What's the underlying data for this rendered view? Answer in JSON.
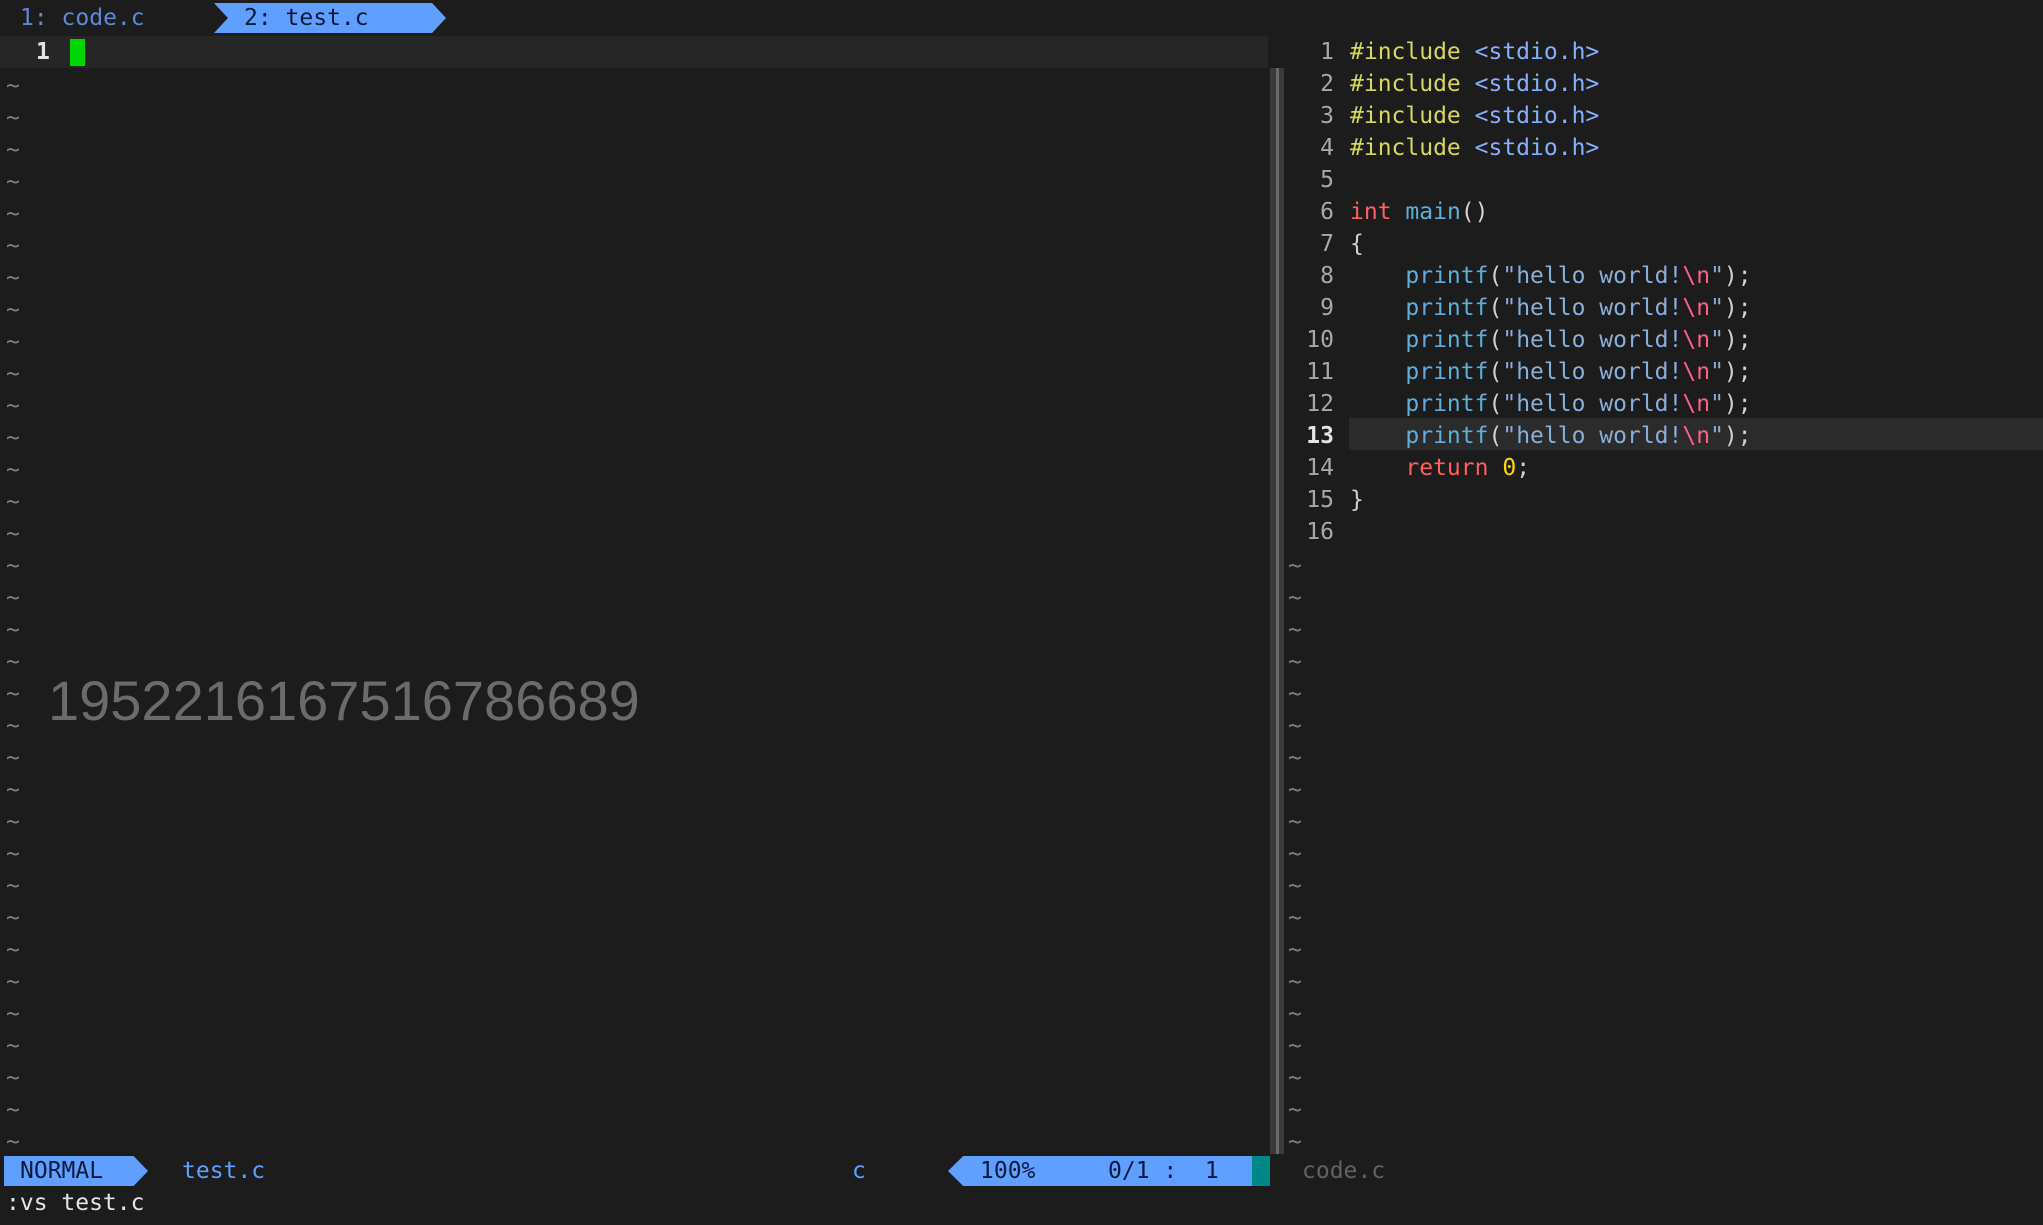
{
  "tabs": [
    {
      "label": "1: code.c"
    },
    {
      "label": "2: test.c"
    }
  ],
  "left_pane": {
    "line_number": "1",
    "tilde": "~"
  },
  "watermark": "19522161675167866​89",
  "right_pane": {
    "lines": [
      {
        "num": "1",
        "tokens": [
          [
            "inc",
            "#include"
          ],
          [
            "punc",
            " "
          ],
          [
            "hdr",
            "<stdio.h>"
          ]
        ]
      },
      {
        "num": "2",
        "tokens": [
          [
            "inc",
            "#include"
          ],
          [
            "punc",
            " "
          ],
          [
            "hdr",
            "<stdio.h>"
          ]
        ]
      },
      {
        "num": "3",
        "tokens": [
          [
            "inc",
            "#include"
          ],
          [
            "punc",
            " "
          ],
          [
            "hdr",
            "<stdio.h>"
          ]
        ]
      },
      {
        "num": "4",
        "tokens": [
          [
            "inc",
            "#include"
          ],
          [
            "punc",
            " "
          ],
          [
            "hdr",
            "<stdio.h>"
          ]
        ]
      },
      {
        "num": "5",
        "tokens": []
      },
      {
        "num": "6",
        "tokens": [
          [
            "kw",
            "int"
          ],
          [
            "punc",
            " "
          ],
          [
            "fn",
            "main"
          ],
          [
            "punc",
            "()"
          ]
        ]
      },
      {
        "num": "7",
        "tokens": [
          [
            "punc",
            "{"
          ]
        ]
      },
      {
        "num": "8",
        "tokens": [
          [
            "punc",
            "    "
          ],
          [
            "fn",
            "printf"
          ],
          [
            "punc",
            "("
          ],
          [
            "str",
            "\"hello world!"
          ],
          [
            "esc",
            "\\n"
          ],
          [
            "str",
            "\""
          ],
          [
            "punc",
            ");"
          ]
        ]
      },
      {
        "num": "9",
        "tokens": [
          [
            "punc",
            "    "
          ],
          [
            "fn",
            "printf"
          ],
          [
            "punc",
            "("
          ],
          [
            "str",
            "\"hello world!"
          ],
          [
            "esc",
            "\\n"
          ],
          [
            "str",
            "\""
          ],
          [
            "punc",
            ");"
          ]
        ]
      },
      {
        "num": "10",
        "tokens": [
          [
            "punc",
            "    "
          ],
          [
            "fn",
            "printf"
          ],
          [
            "punc",
            "("
          ],
          [
            "str",
            "\"hello world!"
          ],
          [
            "esc",
            "\\n"
          ],
          [
            "str",
            "\""
          ],
          [
            "punc",
            ");"
          ]
        ]
      },
      {
        "num": "11",
        "tokens": [
          [
            "punc",
            "    "
          ],
          [
            "fn",
            "printf"
          ],
          [
            "punc",
            "("
          ],
          [
            "str",
            "\"hello world!"
          ],
          [
            "esc",
            "\\n"
          ],
          [
            "str",
            "\""
          ],
          [
            "punc",
            ");"
          ]
        ]
      },
      {
        "num": "12",
        "tokens": [
          [
            "punc",
            "    "
          ],
          [
            "fn",
            "printf"
          ],
          [
            "punc",
            "("
          ],
          [
            "str",
            "\"hello world!"
          ],
          [
            "esc",
            "\\n"
          ],
          [
            "str",
            "\""
          ],
          [
            "punc",
            ");"
          ]
        ]
      },
      {
        "num": "13",
        "current": true,
        "tokens": [
          [
            "punc",
            "    "
          ],
          [
            "fn",
            "printf"
          ],
          [
            "punc",
            "("
          ],
          [
            "str",
            "\"hello world!"
          ],
          [
            "esc",
            "\\n"
          ],
          [
            "str",
            "\""
          ],
          [
            "punc",
            ");"
          ]
        ]
      },
      {
        "num": "14",
        "tokens": [
          [
            "punc",
            "    "
          ],
          [
            "kw",
            "return"
          ],
          [
            "punc",
            " "
          ],
          [
            "num",
            "0"
          ],
          [
            "punc",
            ";"
          ]
        ]
      },
      {
        "num": "15",
        "tokens": [
          [
            "punc",
            "}"
          ]
        ]
      },
      {
        "num": "16",
        "tokens": []
      }
    ]
  },
  "statusline": {
    "mode": "NORMAL",
    "filename": "test.c",
    "filetype": "c",
    "percent": "100%",
    "position": "0/1 :  1",
    "right_filename": "code.c"
  },
  "cmdline": ":vs test.c"
}
